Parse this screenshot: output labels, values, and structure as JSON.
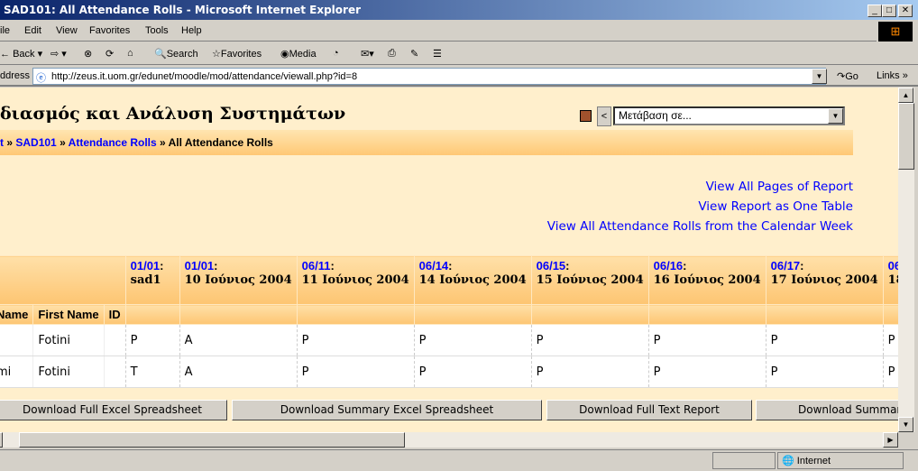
{
  "window": {
    "title": "SAD101: All Attendance Rolls - Microsoft Internet Explorer",
    "minimize": "_",
    "maximize": "□",
    "close": "✕"
  },
  "menu": [
    "ile",
    "Edit",
    "View",
    "Favorites",
    "Tools",
    "Help"
  ],
  "toolbar": {
    "back": "Back",
    "search": "Search",
    "favorites": "Favorites",
    "media": "Media"
  },
  "address": {
    "label": "ddress",
    "url": "http://zeus.it.uom.gr/edunet/moodle/mod/attendance/viewall.php?id=8",
    "go": "Go",
    "links": "Links"
  },
  "page": {
    "course_title": "διασμός και Ανάλυση Συστημάτων",
    "jump_select": "Μετάβαση σε...",
    "prev_button": "<",
    "breadcrumb": {
      "home": "t",
      "course": "SAD101",
      "module": "Attendance Rolls",
      "current": "All Attendance Rolls",
      "sep": "»"
    },
    "links": [
      "View All Pages of Report",
      "View Report as One Table",
      "View All Attendance Rolls from the Calendar Week"
    ],
    "table": {
      "name_headers": [
        "Name",
        "First Name",
        "ID"
      ],
      "sessions": [
        {
          "date": "01/01",
          "title": "sad1"
        },
        {
          "date": "01/01",
          "title": "10 Ιούνιος 2004"
        },
        {
          "date": "06/11",
          "title": "11 Ιούνιος 2004"
        },
        {
          "date": "06/14",
          "title": "14 Ιούνιος 2004"
        },
        {
          "date": "06/15",
          "title": "15 Ιούνιος 2004"
        },
        {
          "date": "06/16",
          "title": "16 Ιούνιος 2004"
        },
        {
          "date": "06/17",
          "title": "17 Ιούνιος 2004"
        },
        {
          "date": "06/",
          "title": "18 Ι"
        }
      ],
      "rows": [
        {
          "last": "i",
          "first": "Fotini",
          "id": "",
          "marks": [
            "P",
            "A",
            "P",
            "P",
            "P",
            "P",
            "P",
            "P"
          ]
        },
        {
          "last": "mi",
          "first": "Fotini",
          "id": "",
          "marks": [
            "T",
            "A",
            "P",
            "P",
            "P",
            "P",
            "P",
            "P"
          ]
        }
      ]
    },
    "buttons": [
      "Download Full Excel Spreadsheet",
      "Download Summary Excel Spreadsheet",
      "Download Full Text Report",
      "Download Summary"
    ]
  },
  "status": {
    "zone": "Internet"
  }
}
